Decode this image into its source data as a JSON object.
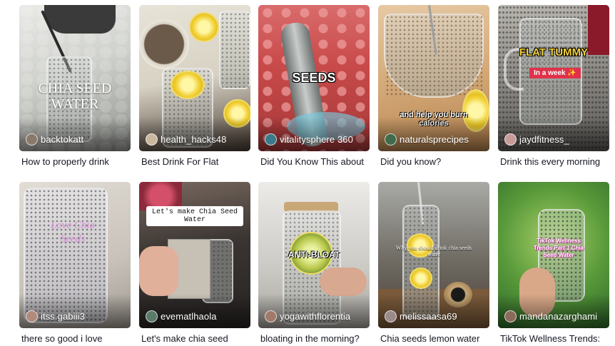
{
  "videos": [
    {
      "username": "backtokatt",
      "caption": "How to properly drink",
      "overlay_text": "CHIA SEED WATER",
      "avatar_color": "#8a7a6a"
    },
    {
      "username": "health_hacks48",
      "caption": "Best Drink For Flat",
      "overlay_text": "",
      "avatar_color": "#c9b8a0"
    },
    {
      "username": "vitalitysphere 360",
      "caption": "Did You Know This about",
      "overlay_text": "SEEDS",
      "avatar_color": "#3a7a8a"
    },
    {
      "username": "naturalsprecipes",
      "caption": "Did you know?",
      "overlay_text": "and help you burn calories",
      "avatar_color": "#3f6b4a"
    },
    {
      "username": "jaydfitness_",
      "caption": "Drink this every morning",
      "overlay_text": "FLAT TUMMY",
      "overlay_badge": "In a week ✨",
      "avatar_color": "#c99a9a"
    },
    {
      "username": "itss.gabiii3",
      "caption": "there so good i love",
      "overlay_text": "Love Chia Seeds",
      "avatar_color": "#b08a7a"
    },
    {
      "username": "evematlhaola",
      "caption": "Let's make chia seed",
      "overlay_text": "Let's make Chia Seed Water",
      "avatar_color": "#5a7a6a"
    },
    {
      "username": "yogawithflorentia",
      "caption": "bloating in the morning?",
      "overlay_text": "ANTI-BLOAT",
      "avatar_color": "#a07a6a"
    },
    {
      "username": "melissaasa69",
      "caption": "Chia seeds lemon water",
      "overlay_text": "Why you should drink chia seeds water",
      "avatar_color": "#9a8a8a"
    },
    {
      "username": "mandanazarghami",
      "caption": "TikTok Wellness Trends:",
      "overlay_text": "TikTok Wellness Trends Part 1 Chia Seed Water",
      "avatar_color": "#8a6a5a"
    }
  ]
}
